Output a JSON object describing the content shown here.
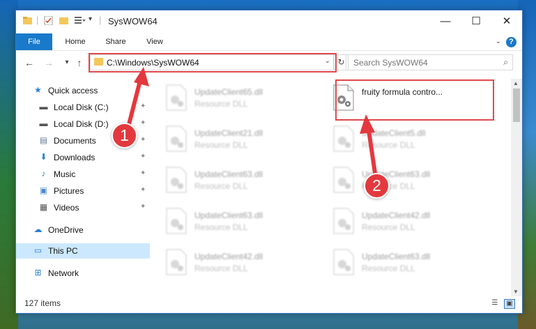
{
  "window": {
    "title": "SysWOW64",
    "controls": {
      "minimize": "—",
      "maximize": "☐",
      "close": "✕"
    }
  },
  "ribbon": {
    "tabs": [
      {
        "label": "File"
      },
      {
        "label": "Home"
      },
      {
        "label": "Share"
      },
      {
        "label": "View"
      }
    ],
    "help": "?"
  },
  "navigation": {
    "address": "C:\\Windows\\SysWOW64",
    "search_placeholder": "Search SysWOW64"
  },
  "sidebar": {
    "items": [
      {
        "label": "Quick access"
      },
      {
        "label": "Local Disk (C:)"
      },
      {
        "label": "Local Disk (D:)"
      },
      {
        "label": "Documents"
      },
      {
        "label": "Downloads"
      },
      {
        "label": "Music"
      },
      {
        "label": "Pictures"
      },
      {
        "label": "Videos"
      },
      {
        "label": "OneDrive"
      },
      {
        "label": "This PC"
      },
      {
        "label": "Network"
      }
    ]
  },
  "files": [
    {
      "name": "UpdateClient65.dll",
      "type": "Resource DLL"
    },
    {
      "name": "fruity formula contro...",
      "type": ""
    },
    {
      "name": "UpdateClient21.dll",
      "type": "Resource DLL"
    },
    {
      "name": "UpdateClient5.dll",
      "type": "Resource DLL"
    },
    {
      "name": "UpdateClient63.dll",
      "type": "Resource DLL"
    },
    {
      "name": "UpdateClient63.dll",
      "type": "Resource DLL"
    },
    {
      "name": "UpdateClient63.dll",
      "type": "Resource DLL"
    },
    {
      "name": "UpdateClient42.dll",
      "type": "Resource DLL"
    },
    {
      "name": "UpdateClient42.dll",
      "type": "Resource DLL"
    },
    {
      "name": "UpdateClient63.dll",
      "type": "Resource DLL"
    }
  ],
  "status": {
    "item_count": "127 items"
  },
  "callouts": {
    "first": "1",
    "second": "2"
  },
  "colors": {
    "accent": "#1979ca",
    "highlight": "#e0484c",
    "selected": "#cce8ff"
  }
}
